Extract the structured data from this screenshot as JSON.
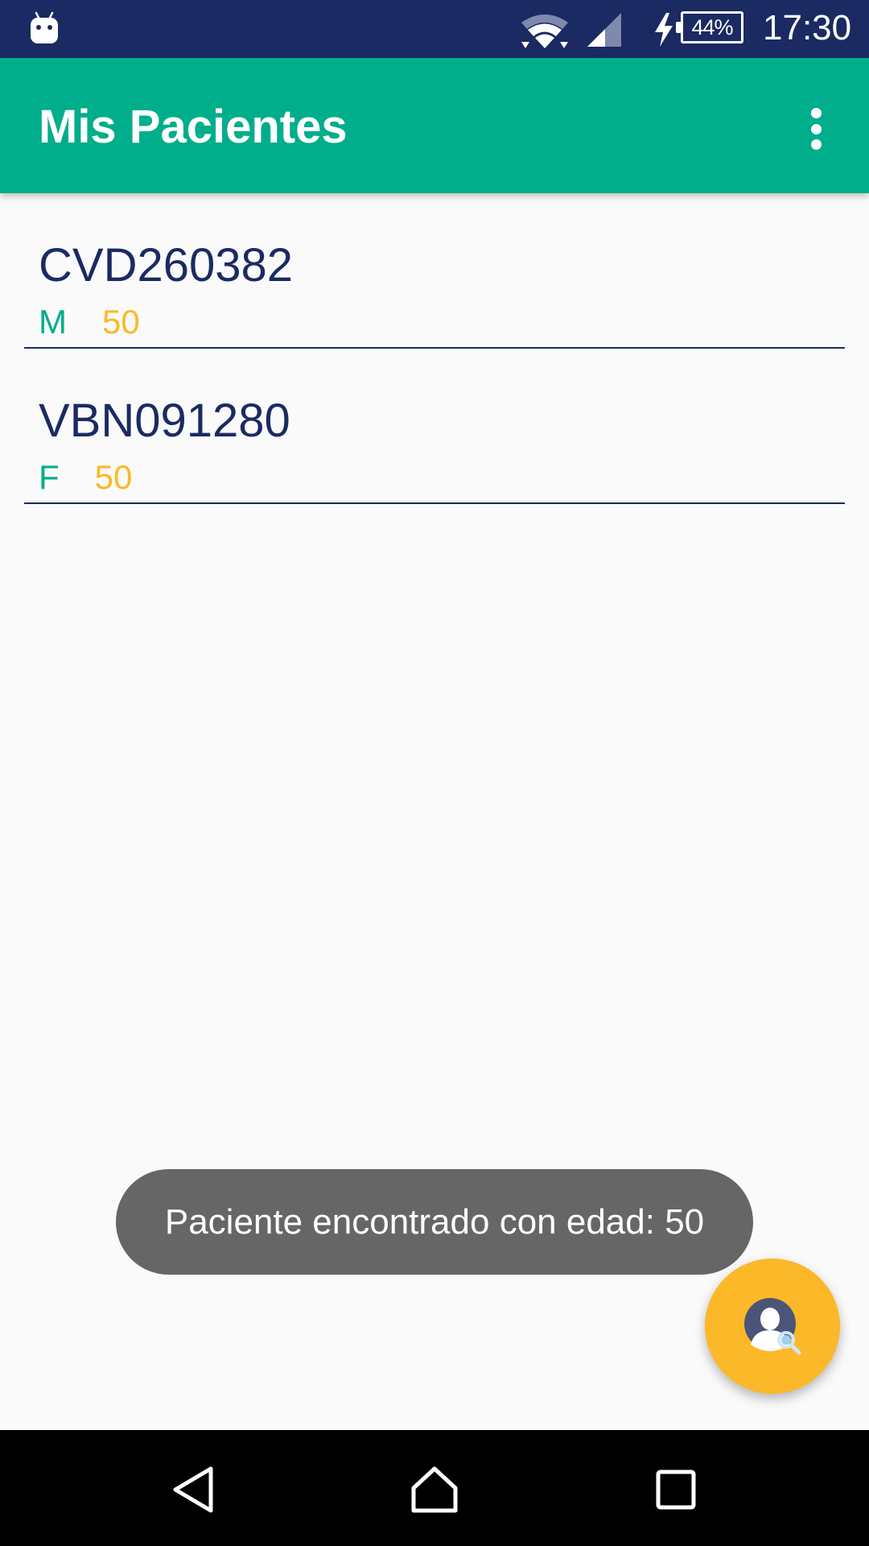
{
  "status_bar": {
    "battery_percent": "44%",
    "time": "17:30",
    "icons": [
      "android-icon",
      "wifi-icon",
      "signal-icon",
      "charging-bolt-icon",
      "battery-icon"
    ]
  },
  "app_bar": {
    "title": "Mis Pacientes",
    "menu_icon": "more-vert-icon"
  },
  "patients": [
    {
      "id": "CVD260382",
      "sex": "M",
      "age": "50"
    },
    {
      "id": "VBN091280",
      "sex": "F",
      "age": "50"
    }
  ],
  "toast": {
    "message": "Paciente encontrado con edad: 50"
  },
  "fab": {
    "icon": "search-patient-icon"
  },
  "nav_bar": {
    "icons": [
      "back-icon",
      "home-icon",
      "recent-apps-icon"
    ]
  },
  "colors": {
    "primary": "#00ae8b",
    "primary_dark": "#1b2a63",
    "accent": "#fbb829",
    "toast_bg": "#666666",
    "background": "#fafafa"
  }
}
